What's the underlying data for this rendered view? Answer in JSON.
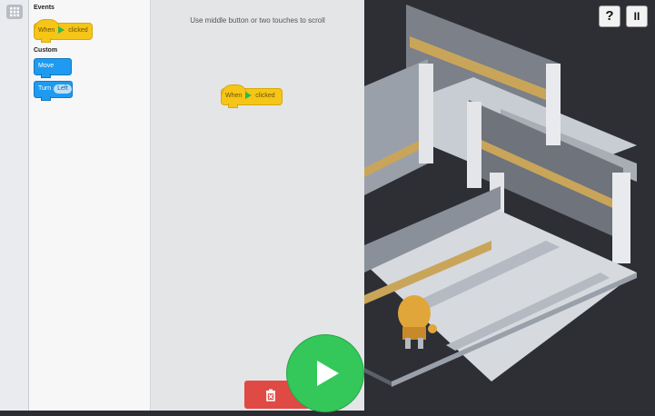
{
  "palette": {
    "events_title": "Events",
    "custom_title": "Custom",
    "when_label": "When",
    "clicked_label": "clicked",
    "move_label": "Move",
    "turn_label": "Turn",
    "turn_dir": "Left"
  },
  "workspace": {
    "hint": "Use middle button or two touches to scroll",
    "block_when": "When",
    "block_clicked": "clicked"
  },
  "toolbar": {
    "help_label": "?",
    "pause_label": "II"
  },
  "colors": {
    "event_block": "#f5c518",
    "custom_block": "#1e9bf0",
    "run_button": "#34c759",
    "delete_button": "#e04a45",
    "scene_bg": "#2d2f35"
  },
  "icons": [
    "grid-icon",
    "flag-icon",
    "play-icon",
    "trash-icon",
    "help-icon",
    "pause-icon"
  ]
}
